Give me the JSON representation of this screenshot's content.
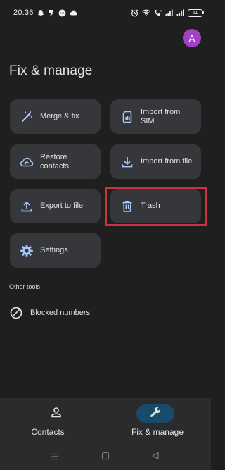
{
  "status_bar": {
    "time": "20:36",
    "battery": "51"
  },
  "header": {
    "avatar_letter": "A",
    "title": "Fix & manage"
  },
  "tiles": {
    "merge": {
      "label": "Merge & fix",
      "icon": "magic-wand-icon"
    },
    "import_sim": {
      "label": "Import from SIM",
      "icon": "sim-card-icon"
    },
    "restore": {
      "label": "Restore contacts",
      "icon": "cloud-restore-icon"
    },
    "import_file": {
      "label": "Import from file",
      "icon": "download-icon"
    },
    "export": {
      "label": "Export to file",
      "icon": "upload-icon"
    },
    "trash": {
      "label": "Trash",
      "icon": "trash-icon"
    },
    "settings": {
      "label": "Settings",
      "icon": "gear-icon"
    }
  },
  "other_tools": {
    "heading": "Other tools",
    "blocked_numbers": "Blocked numbers"
  },
  "bottom_nav": {
    "contacts": "Contacts",
    "fix_manage": "Fix & manage",
    "active": "fix_manage"
  },
  "colors": {
    "background": "#1f1f1f",
    "tile": "#35373a",
    "accent_icon": "#a8c7fa",
    "avatar": "#a142c4",
    "active_pill": "#174b69",
    "highlight": "#c8333f"
  }
}
